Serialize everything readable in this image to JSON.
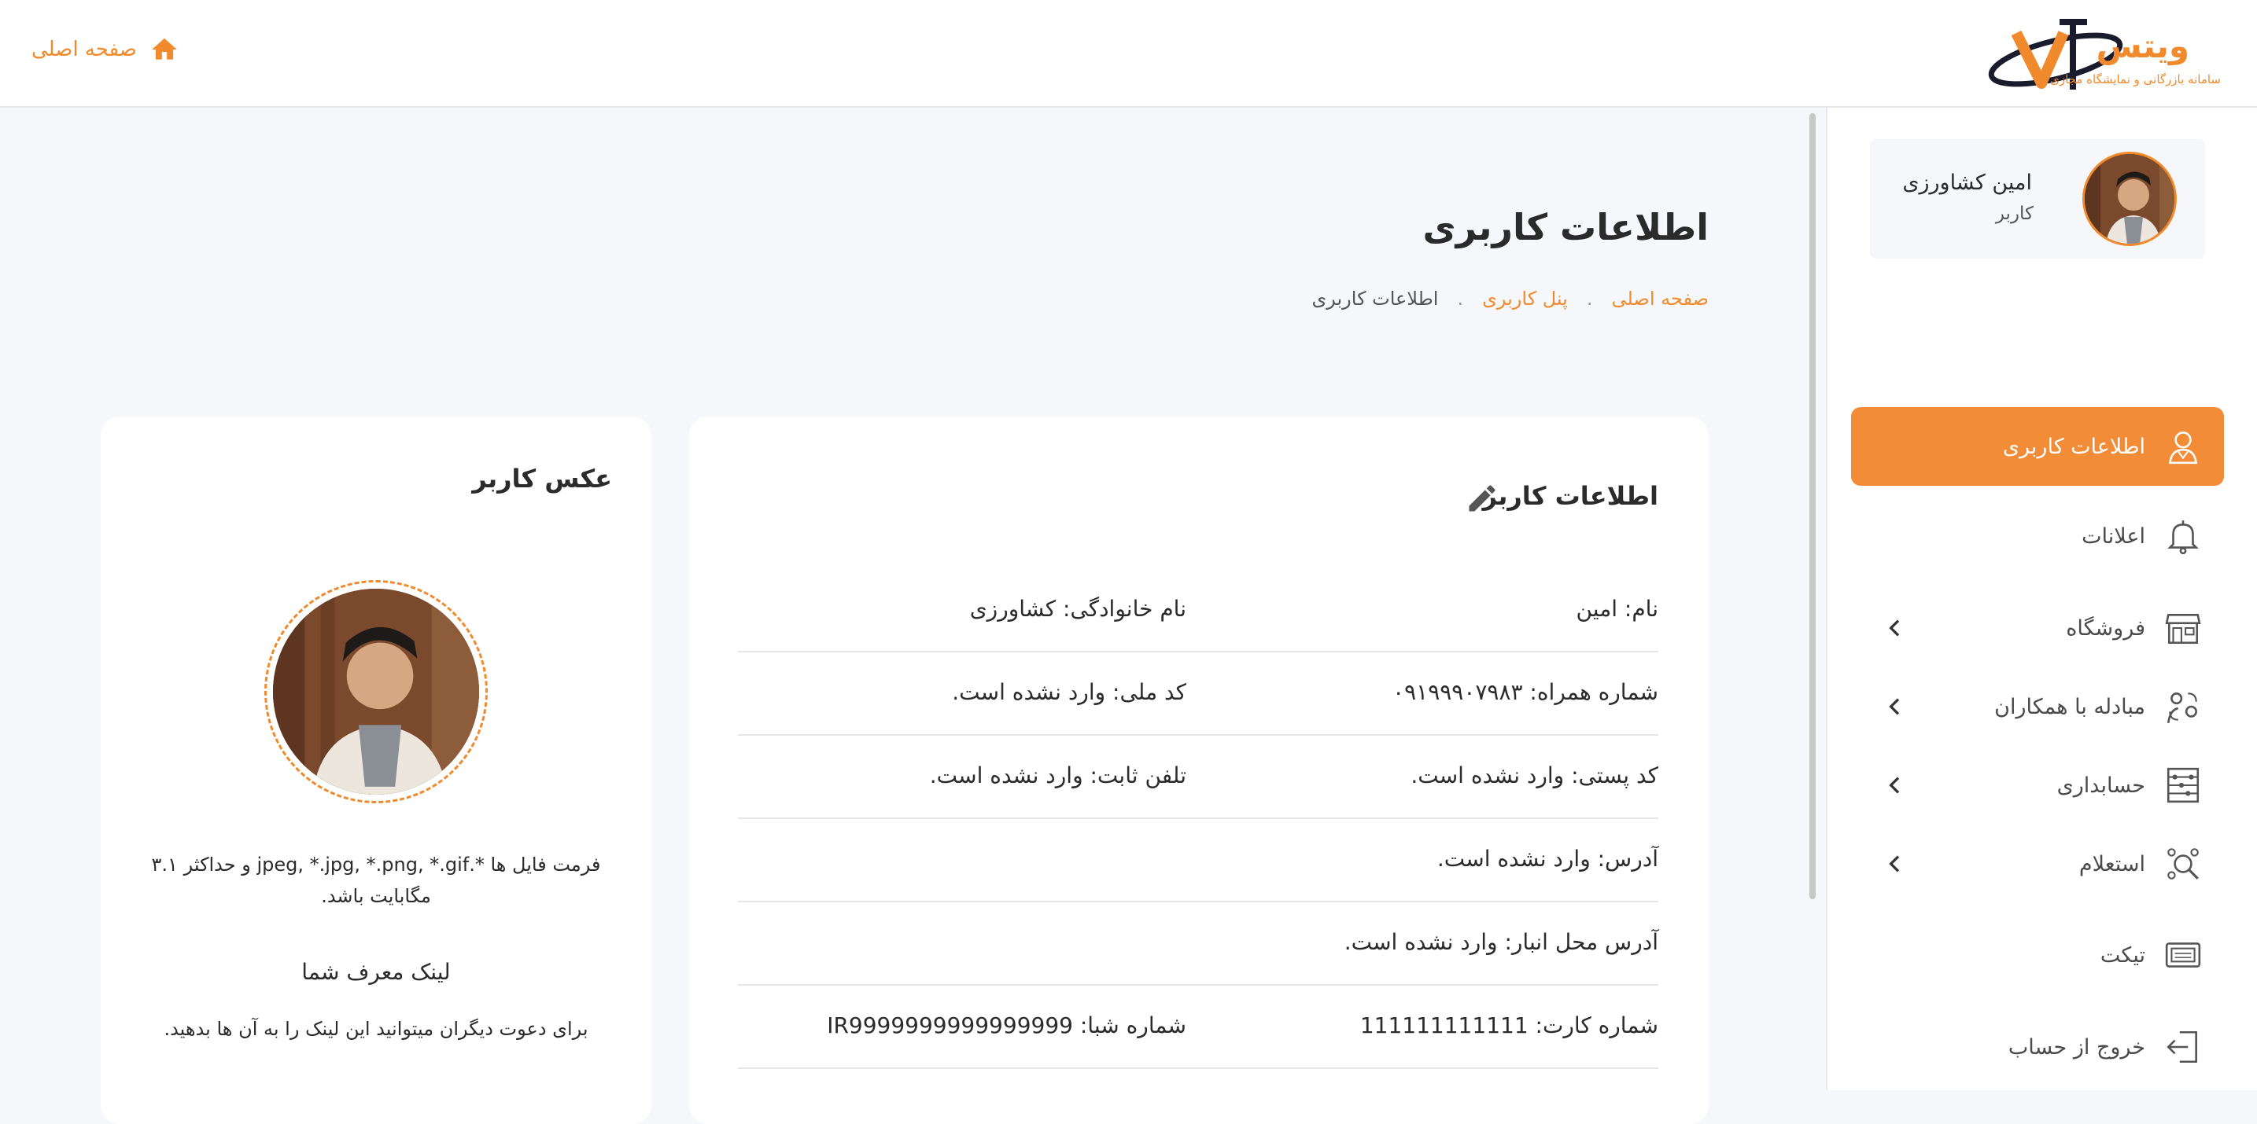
{
  "header": {
    "home_label": "صفحه اصلی",
    "logo_brand": "ویتس",
    "logo_tagline": "سامانه بازرگانی و نمایشگاه مجازی"
  },
  "profile": {
    "name": "امین کشاورزی",
    "role": "کاربر"
  },
  "sidebar": {
    "items": [
      {
        "label": "اطلاعات کاربری",
        "icon": "user-icon",
        "active": true,
        "expandable": false
      },
      {
        "label": "اعلانات",
        "icon": "bell-icon",
        "active": false,
        "expandable": false
      },
      {
        "label": "فروشگاه",
        "icon": "store-icon",
        "active": false,
        "expandable": true
      },
      {
        "label": "مبادله با همکاران",
        "icon": "exchange-icon",
        "active": false,
        "expandable": true
      },
      {
        "label": "حسابداری",
        "icon": "abacus-icon",
        "active": false,
        "expandable": true
      },
      {
        "label": "استعلام",
        "icon": "inquiry-icon",
        "active": false,
        "expandable": true
      },
      {
        "label": "تیکت",
        "icon": "ticket-icon",
        "active": false,
        "expandable": false
      },
      {
        "label": "خروج از حساب",
        "icon": "logout-icon",
        "active": false,
        "expandable": false
      }
    ]
  },
  "page": {
    "title": "اطلاعات کاربری",
    "breadcrumb": {
      "home": "صفحه اصلی",
      "panel": "پنل کاربری",
      "current": "اطلاعات کاربری",
      "separator": "."
    }
  },
  "info_card": {
    "title": "اطلاعات کاربر",
    "rows": [
      {
        "right": "نام: امین",
        "left": "نام خانوادگی: کشاورزی"
      },
      {
        "right": "شماره همراه: ۰۹۱۹۹۹۰۷۹۸۳",
        "left": "کد ملی: وارد نشده است."
      },
      {
        "right": "کد پستی: وارد نشده است.",
        "left": "تلفن ثابت: وارد نشده است."
      },
      {
        "right": "آدرس: وارد نشده است.",
        "left": ""
      },
      {
        "right": "آدرس محل انبار: وارد نشده است.",
        "left": ""
      },
      {
        "right": "شماره کارت: 111111111111",
        "left": "شماره شبا: IR9999999999999999"
      }
    ]
  },
  "photo_card": {
    "title": "عکس کاربر",
    "hint": "فرمت فایل ها *.jpeg, *.jpg, *.png, *.gif و حداکثر ۳.۱ مگابایت باشد.",
    "referral_title": "لینک معرف شما",
    "referral_desc": "برای دعوت دیگران میتوانید این لینک را به آن ها بدهید."
  },
  "colors": {
    "accent": "#f28c36",
    "page_bg": "#f5f7fa"
  }
}
